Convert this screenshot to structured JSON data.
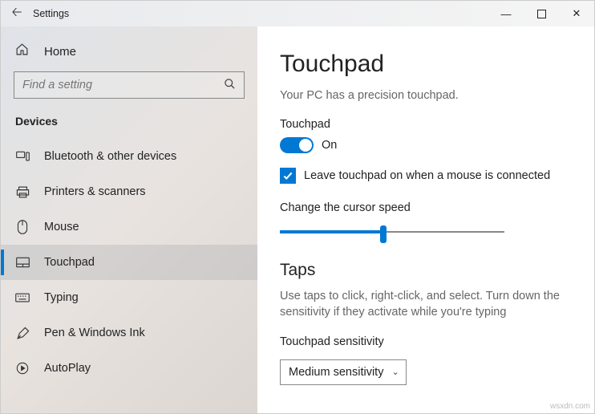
{
  "titlebar": {
    "title": "Settings"
  },
  "sidebar": {
    "home_label": "Home",
    "search_placeholder": "Find a setting",
    "group_header": "Devices",
    "items": [
      {
        "label": "Bluetooth & other devices"
      },
      {
        "label": "Printers & scanners"
      },
      {
        "label": "Mouse"
      },
      {
        "label": "Touchpad"
      },
      {
        "label": "Typing"
      },
      {
        "label": "Pen & Windows Ink"
      },
      {
        "label": "AutoPlay"
      }
    ]
  },
  "main": {
    "heading": "Touchpad",
    "precision_text": "Your PC has a precision touchpad.",
    "touchpad_label": "Touchpad",
    "toggle_state": "On",
    "leave_on_label": "Leave touchpad on when a mouse is connected",
    "cursor_speed_label": "Change the cursor speed",
    "taps_heading": "Taps",
    "taps_desc": "Use taps to click, right-click, and select. Turn down the sensitivity if they activate while you're typing",
    "sensitivity_label": "Touchpad sensitivity",
    "sensitivity_value": "Medium sensitivity"
  },
  "watermark": "wsxdn.com"
}
